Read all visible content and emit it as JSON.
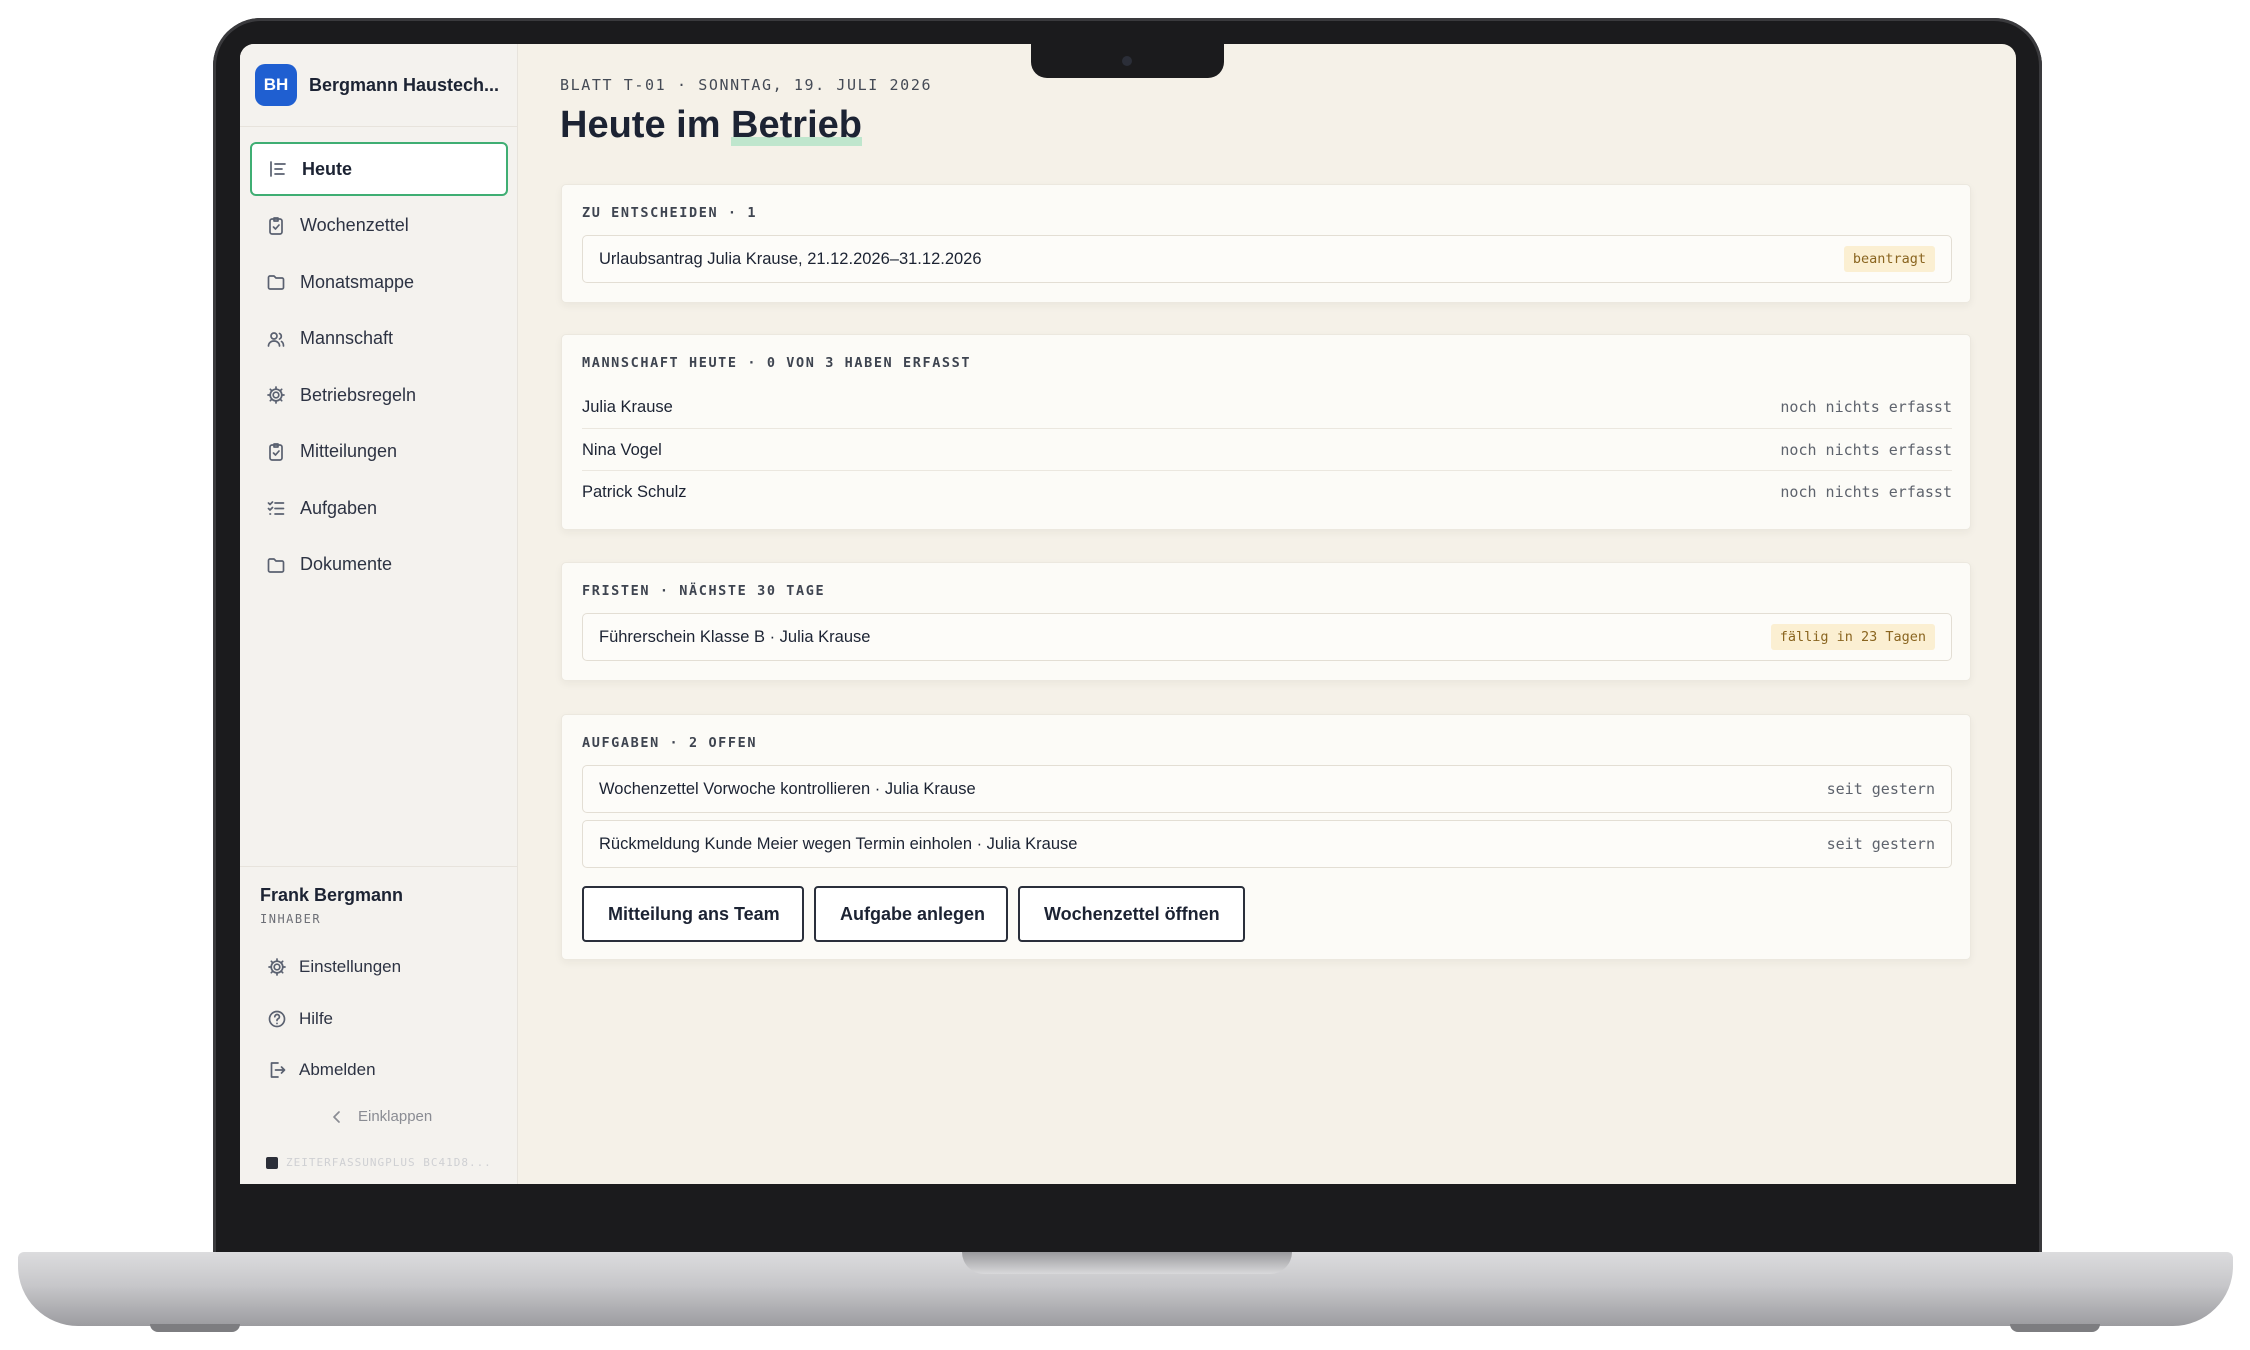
{
  "sidebar": {
    "brand_initials": "BH",
    "brand_name": "Bergmann Haustech...",
    "nav": [
      {
        "label": "Heute",
        "icon": "list-icon"
      },
      {
        "label": "Wochenzettel",
        "icon": "clipboard-icon"
      },
      {
        "label": "Monatsmappe",
        "icon": "folder-icon"
      },
      {
        "label": "Mannschaft",
        "icon": "users-icon"
      },
      {
        "label": "Betriebsregeln",
        "icon": "gear-icon"
      },
      {
        "label": "Mitteilungen",
        "icon": "clipboard-icon"
      },
      {
        "label": "Aufgaben",
        "icon": "checklist-icon"
      },
      {
        "label": "Dokumente",
        "icon": "folder-icon"
      }
    ],
    "user_name": "Frank Bergmann",
    "user_role": "INHABER",
    "settings": "Einstellungen",
    "help": "Hilfe",
    "logout": "Abmelden",
    "collapse": "Einklappen",
    "version": "ZEITERFASSUNGPLUS BC41D8..."
  },
  "header": {
    "sheet_meta": "BLATT T-01 · SONNTAG, 19. JULI 2026",
    "title_part1": "Heute im ",
    "title_part2": "Betrieb"
  },
  "decide": {
    "heading": "ZU ENTSCHEIDEN · 1",
    "item": "Urlaubsantrag Julia Krause, 21.12.2026–31.12.2026",
    "badge": "beantragt"
  },
  "team": {
    "heading": "MANNSCHAFT HEUTE · 0 VON 3 HABEN ERFASST",
    "rows": [
      {
        "name": "Julia Krause",
        "status": "noch nichts erfasst"
      },
      {
        "name": "Nina Vogel",
        "status": "noch nichts erfasst"
      },
      {
        "name": "Patrick Schulz",
        "status": "noch nichts erfasst"
      }
    ]
  },
  "deadlines": {
    "heading": "FRISTEN · NÄCHSTE 30 TAGE",
    "item": "Führerschein Klasse B · Julia Krause",
    "badge": "fällig in 23 Tagen"
  },
  "tasks": {
    "heading": "AUFGABEN · 2 OFFEN",
    "items": [
      {
        "label": "Wochenzettel Vorwoche kontrollieren · Julia Krause",
        "since": "seit gestern"
      },
      {
        "label": "Rückmeldung Kunde Meier wegen Termin einholen · Julia Krause",
        "since": "seit gestern"
      }
    ],
    "btn_message": "Mitteilung ans Team",
    "btn_task": "Aufgabe anlegen",
    "btn_week": "Wochenzettel öffnen"
  },
  "colors": {
    "brand": "#1f5fd1",
    "active_border": "#3fae73",
    "badge_bg": "#fbefd2",
    "badge_text": "#8a6520",
    "background": "#f5f1e8"
  }
}
